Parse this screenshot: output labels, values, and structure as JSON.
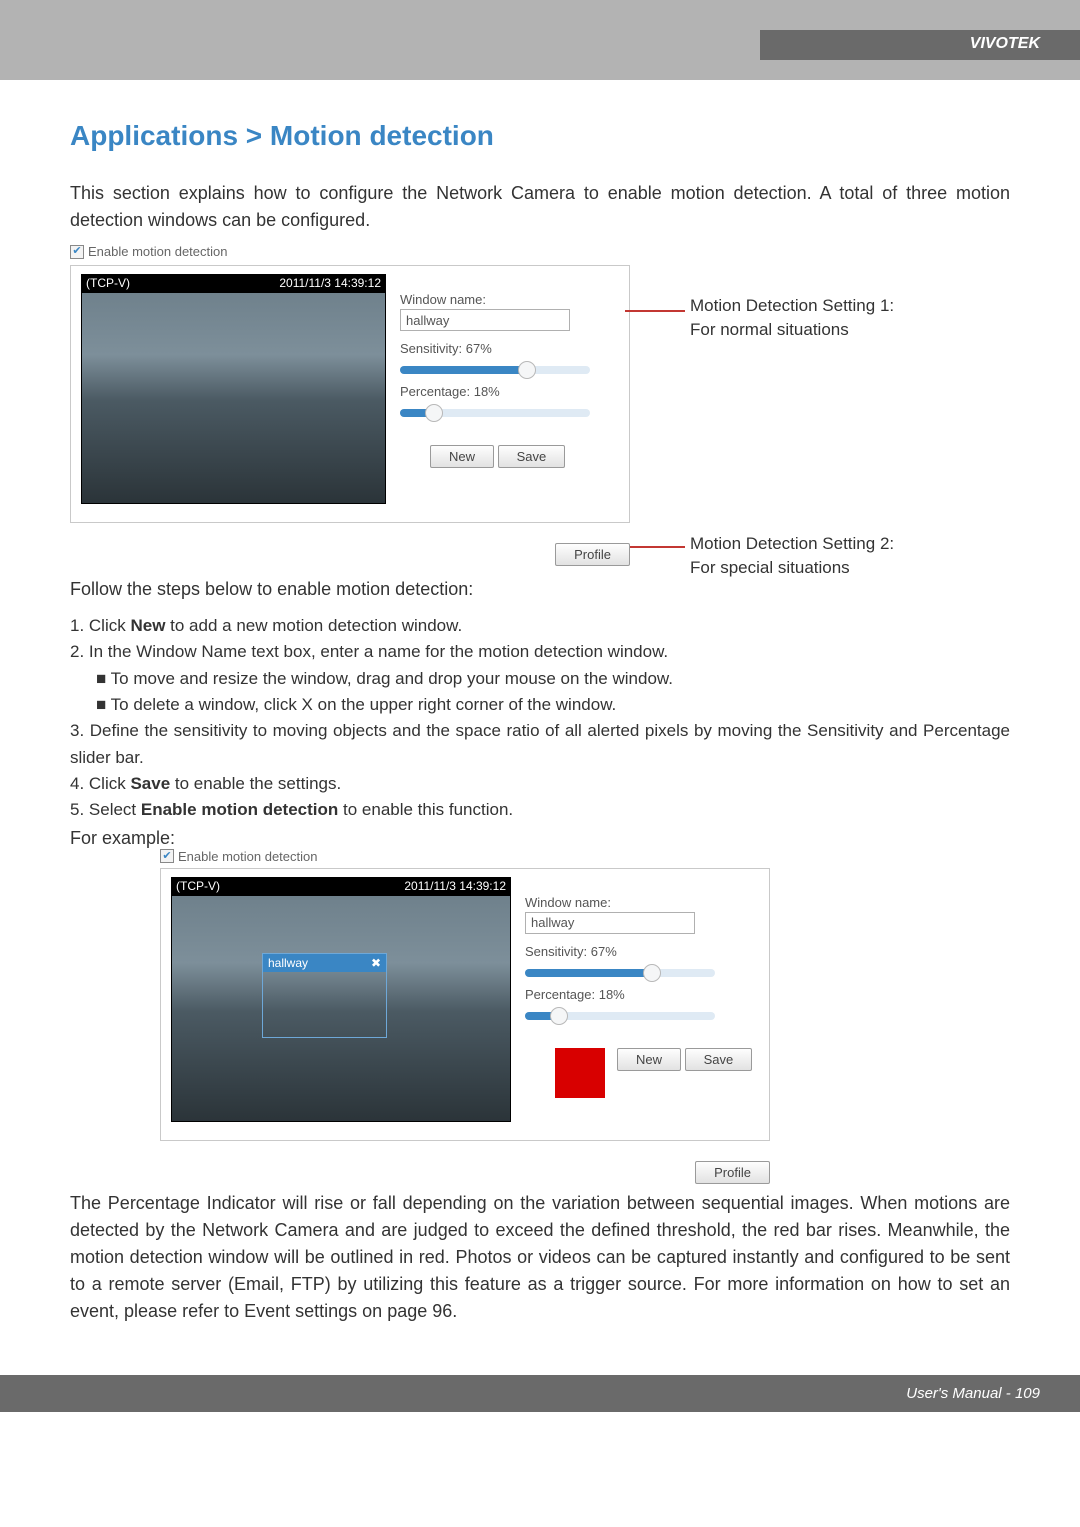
{
  "header": {
    "brand": "VIVOTEK"
  },
  "title": "Applications > Motion detection",
  "intro": "This section explains how to configure the Network Camera to enable motion detection. A total of three motion detection windows can be configured.",
  "panel1": {
    "enable_label": "Enable motion detection",
    "stream_name": "(TCP-V)",
    "timestamp": "2011/11/3 14:39:12",
    "window_name_label": "Window name:",
    "window_name_value": "hallway",
    "sensitivity_label": "Sensitivity: 67%",
    "sensitivity_value": 67,
    "percentage_label": "Percentage: 18%",
    "percentage_value": 18,
    "new_btn": "New",
    "save_btn": "Save",
    "profile_btn": "Profile"
  },
  "annotations": {
    "a1_line1": "Motion Detection Setting 1:",
    "a1_line2": "For normal situations",
    "a2_line1": "Motion Detection Setting 2:",
    "a2_line2": "For special situations"
  },
  "steps_intro": "Follow the steps below to enable motion detection:",
  "steps": {
    "s1_pre": "1. Click ",
    "s1_bold": "New",
    "s1_post": " to add a new motion detection window.",
    "s2": "2. In the Window Name text box, enter a name for the motion detection window.",
    "s2a": "■ To move and resize the window, drag and drop your mouse on the window.",
    "s2b": "■ To delete a window, click X on the upper right corner of the window.",
    "s3": "3. Define the sensitivity to moving objects and the space ratio of all alerted pixels by moving the Sensitivity and Percentage slider bar.",
    "s4_pre": "4. Click ",
    "s4_bold": "Save",
    "s4_post": " to enable the settings.",
    "s5_pre": "5. Select ",
    "s5_bold": "Enable motion detection",
    "s5_post": " to enable this function."
  },
  "for_example": "For example:",
  "panel2": {
    "enable_label": "Enable motion detection",
    "stream_name": "(TCP-V)",
    "timestamp": "2011/11/3 14:39:12",
    "md_window_label": "hallway",
    "window_name_label": "Window name:",
    "window_name_value": "hallway",
    "sensitivity_label": "Sensitivity: 67%",
    "sensitivity_value": 67,
    "percentage_label": "Percentage: 18%",
    "percentage_value": 18,
    "new_btn": "New",
    "save_btn": "Save",
    "profile_btn": "Profile"
  },
  "closing": "The Percentage Indicator will rise or fall depending on the variation between sequential images. When motions are detected by the Network Camera and are judged to exceed the defined threshold, the red bar rises. Meanwhile, the motion detection window will be outlined in red. Photos or videos can be captured instantly and configured to be sent to a remote server (Email, FTP) by utilizing this feature as a trigger source. For more information on how to set an event, please refer to Event settings on page 96.",
  "footer": "User's Manual - 109"
}
